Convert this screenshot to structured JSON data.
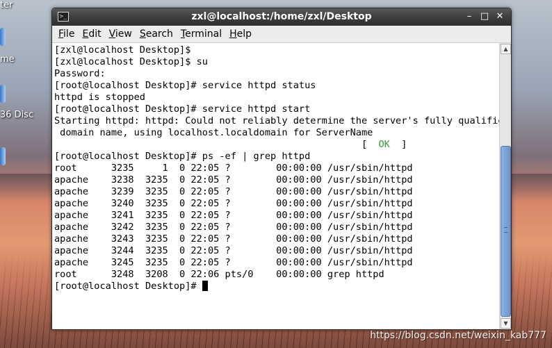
{
  "desktop": {
    "labels": [
      "ter",
      "me",
      "36 Disc"
    ],
    "watermark": "https://blog.csdn.net/weixin_kab777"
  },
  "window": {
    "title": "zxl@localhost:/home/zxl/Desktop",
    "controls": {
      "minimize": "–",
      "maximize": "□",
      "close": "✕"
    }
  },
  "menu": {
    "file": {
      "mnemonic": "F",
      "rest": "ile"
    },
    "edit": {
      "mnemonic": "E",
      "rest": "dit"
    },
    "view": {
      "mnemonic": "V",
      "rest": "iew"
    },
    "search": {
      "mnemonic": "S",
      "rest": "earch"
    },
    "terminal": {
      "mnemonic": "T",
      "rest": "erminal"
    },
    "help": {
      "mnemonic": "H",
      "rest": "elp"
    }
  },
  "terminal": {
    "lines": [
      "[zxl@localhost Desktop]$",
      "[zxl@localhost Desktop]$ su",
      "Password:",
      "[root@localhost Desktop]# service httpd status",
      "httpd is stopped",
      "[root@localhost Desktop]# service httpd start",
      "Starting httpd: httpd: Could not reliably determine the server's fully qualified",
      " domain name, using localhost.localdomain for ServerName"
    ],
    "ok_line": {
      "prefix": "                                                      [  ",
      "ok": "OK",
      "suffix": "  ]"
    },
    "lines_after": [
      "[root@localhost Desktop]# ps -ef | grep httpd",
      "root      3235     1  0 22:05 ?        00:00:00 /usr/sbin/httpd",
      "apache    3238  3235  0 22:05 ?        00:00:00 /usr/sbin/httpd",
      "apache    3239  3235  0 22:05 ?        00:00:00 /usr/sbin/httpd",
      "apache    3240  3235  0 22:05 ?        00:00:00 /usr/sbin/httpd",
      "apache    3241  3235  0 22:05 ?        00:00:00 /usr/sbin/httpd",
      "apache    3242  3235  0 22:05 ?        00:00:00 /usr/sbin/httpd",
      "apache    3243  3235  0 22:05 ?        00:00:00 /usr/sbin/httpd",
      "apache    3244  3235  0 22:05 ?        00:00:00 /usr/sbin/httpd",
      "apache    3245  3235  0 22:05 ?        00:00:00 /usr/sbin/httpd",
      "root      3248  3208  0 22:06 pts/0    00:00:00 grep httpd"
    ],
    "prompt": "[root@localhost Desktop]# "
  },
  "colors": {
    "ok": "#2ea02e",
    "scroll_thumb": "#7fa2d6"
  }
}
